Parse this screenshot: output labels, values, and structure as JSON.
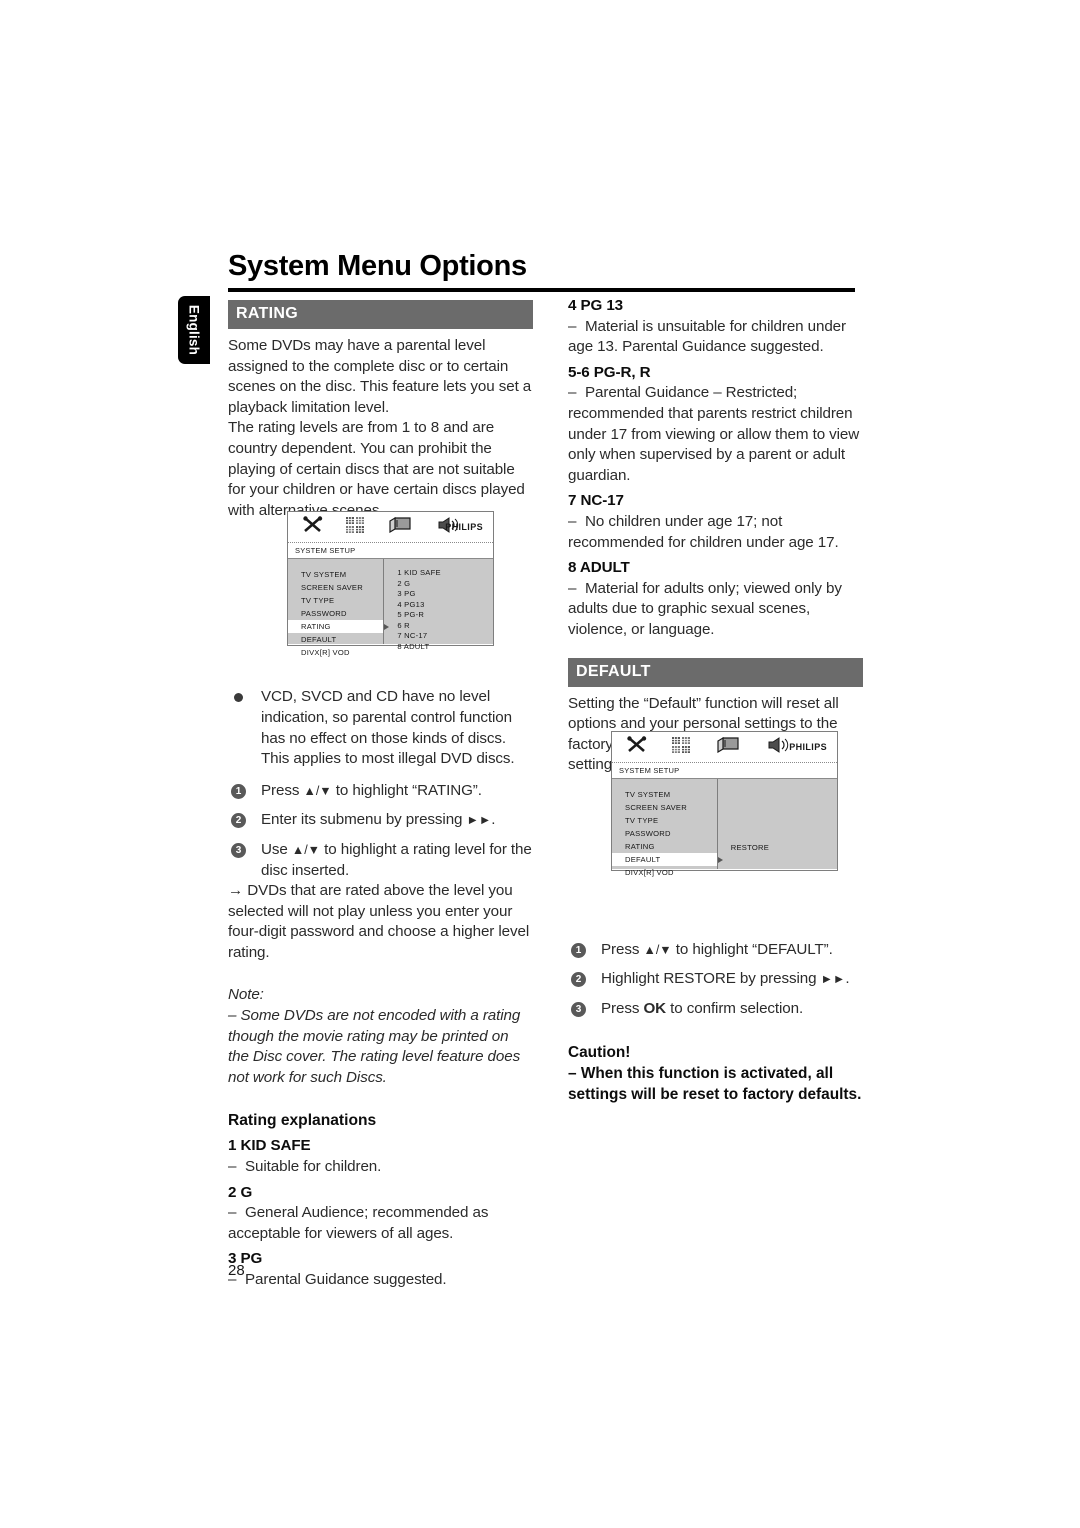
{
  "page": {
    "title": "System Menu Options",
    "language_tab": "English",
    "page_number": "28"
  },
  "left_column": {
    "rating_section": {
      "header": "RATING",
      "paragraphs": [
        "Some DVDs may have a parental level assigned to the complete disc or to certain scenes on the disc. This feature lets you set a playback limitation level.",
        "The rating levels are from 1 to 8 and are country dependent. You can prohibit the playing of certain discs that are not suitable for your children or have certain discs played with alternative scenes."
      ],
      "bullet": "VCD, SVCD and CD have no level indication, so parental control function has no effect on those kinds of discs. This applies to most illegal DVD discs.",
      "steps": [
        {
          "num": "1",
          "text_before": "Press ",
          "glyph": "▲/▼",
          "text_after": " to highlight “RATING”."
        },
        {
          "num": "2",
          "text_before": "Enter its submenu by pressing ",
          "glyph": "►►",
          "text_after": "."
        },
        {
          "num": "3",
          "text_before": "Use ",
          "glyph": "▲/▼",
          "text_after": " to highlight a rating level for the disc inserted."
        }
      ],
      "step3_arrow": "→ DVDs that are rated above the level you selected will not play unless you enter your four-digit password and choose a higher level rating.",
      "note_label": "Note:",
      "note_text": "–  Some DVDs are not encoded with a rating though the movie rating may be printed on the Disc cover. The rating level feature does not work for such Discs.",
      "explanations_heading": "Rating explanations",
      "explanations": [
        {
          "title": "1 KID SAFE",
          "desc": "Suitable for children."
        },
        {
          "title": "2 G",
          "desc": "General Audience; recommended as acceptable for viewers of all ages."
        },
        {
          "title": "3 PG",
          "desc": "Parental Guidance suggested."
        }
      ]
    },
    "osd_rating": {
      "setup_label": "SYSTEM SETUP",
      "brand": "PHILIPS",
      "icons": [
        "tools-icon",
        "grid-icon",
        "tv-icon",
        "speaker-icon"
      ],
      "menu_items": [
        "TV SYSTEM",
        "SCREEN SAVER",
        "TV TYPE",
        "PASSWORD",
        "RATING",
        "DEFAULT",
        "DIVX[R] VOD"
      ],
      "selected_item": "RATING",
      "submenu_items": [
        "1 KID SAFE",
        "2 G",
        "3 PG",
        "4 PG13",
        "5 PG-R",
        "6 R",
        "7 NC-17",
        "8 ADULT"
      ],
      "submenu_cursor_index": 5
    }
  },
  "right_column": {
    "explanations": [
      {
        "title": "4 PG 13",
        "desc": "Material is unsuitable for children under age 13. Parental Guidance suggested."
      },
      {
        "title": "5-6 PG-R, R",
        "desc": "Parental Guidance – Restricted; recommended that parents restrict children under 17 from viewing or allow them to view only when supervised by a parent or adult guardian."
      },
      {
        "title": "7 NC-17",
        "desc": "No children under age 17; not recommended for children under age 17."
      },
      {
        "title": "8 ADULT",
        "desc": "Material for adults only; viewed only by adults due to graphic sexual scenes, violence, or language."
      }
    ],
    "default_section": {
      "header": "DEFAULT",
      "paragraph": "Setting the “Default” function will reset all options and your personal settings to the factory defaults and all your personal settings will be erased.",
      "steps": [
        {
          "num": "1",
          "text_before": "Press ",
          "glyph": "▲/▼",
          "text_after": " to highlight “DEFAULT”."
        },
        {
          "num": "2",
          "text_before": "Highlight RESTORE by pressing ",
          "glyph": "►►",
          "text_after": "."
        },
        {
          "num": "3",
          "text_before": "Press ",
          "glyph": "OK",
          "text_after": " to confirm selection."
        }
      ],
      "caution_label": "Caution!",
      "caution_text": "–  When this function is activated, all settings will be reset to factory defaults."
    },
    "osd_default": {
      "setup_label": "SYSTEM SETUP",
      "brand": "PHILIPS",
      "icons": [
        "tools-icon",
        "grid-icon",
        "tv-icon",
        "speaker-icon"
      ],
      "menu_items": [
        "TV SYSTEM",
        "SCREEN SAVER",
        "TV TYPE",
        "PASSWORD",
        "RATING",
        "DEFAULT",
        "DIVX[R] VOD"
      ],
      "selected_item": "DEFAULT",
      "submenu_items": [
        "RESTORE"
      ]
    }
  },
  "colors": {
    "section_bar": "#6b6b6b",
    "osd_background": "#c9c9c9",
    "tab_background": "#000000"
  }
}
